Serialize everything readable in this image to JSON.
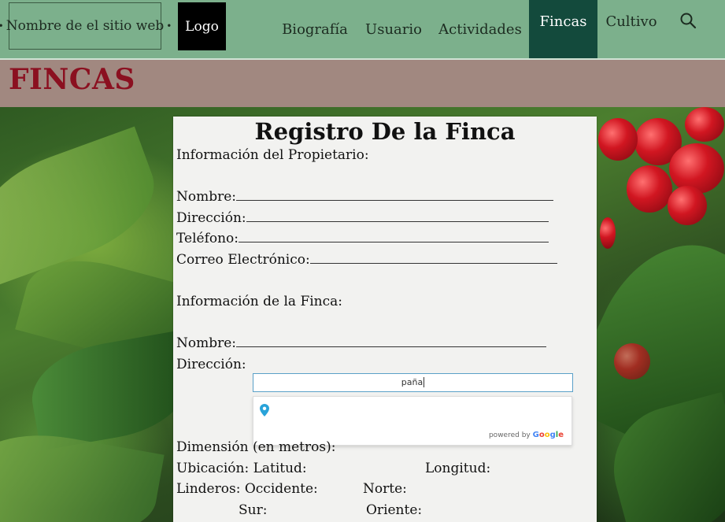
{
  "nav": {
    "site_name": "Nombre de el sitio web",
    "logo": "Logo",
    "items": [
      {
        "label": "Biografía"
      },
      {
        "label": "Usuario"
      },
      {
        "label": "Actividades"
      },
      {
        "label": "Fincas"
      },
      {
        "label": "Cultivo"
      }
    ],
    "search_icon": "search-icon"
  },
  "page_title": "FINCAS",
  "form": {
    "title": "Registro De la Finca",
    "owner_section": "Información del Propietario:",
    "owner_name": "Nombre:",
    "owner_address": "Dirección:",
    "owner_phone": "Teléfono:",
    "owner_email": "Correo Electrónico:",
    "farm_section": "Información de la Finca:",
    "farm_name": "Nombre:",
    "farm_address": "Dirección:",
    "address_input_value": "paña",
    "powered_by": "powered by",
    "google": "Google",
    "dimension": "Dimensión (en metros):",
    "location": "Ubicación: Latitud:",
    "longitude": "Longitud:",
    "boundaries": "Linderos: Occidente:",
    "north": "Norte:",
    "south": "Sur:",
    "east": "Oriente:"
  },
  "colors": {
    "nav_bg": "#7cb08c",
    "nav_active": "#134a3c",
    "title_bar": "#a18880",
    "title_text": "#8b1020"
  }
}
